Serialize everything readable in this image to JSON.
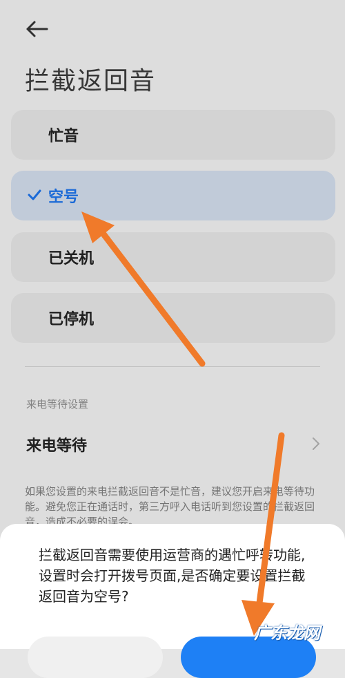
{
  "header": {
    "title": "拦截返回音",
    "back_icon": "arrow-left-icon"
  },
  "options": [
    {
      "label": "忙音",
      "selected": false
    },
    {
      "label": "空号",
      "selected": true
    },
    {
      "label": "已关机",
      "selected": false
    },
    {
      "label": "已停机",
      "selected": false
    }
  ],
  "call_waiting": {
    "section_label": "来电等待设置",
    "row_label": "来电等待",
    "description": "如果您设置的来电拦截返回音不是忙音，建议您开启来电等待功能。避免您正在通话时，第三方呼入电话听到您设置的拦截返回音，造成不必要的误会。"
  },
  "dialog": {
    "message": "拦截返回音需要使用运营商的遇忙呼转功能,设置时会打开拨号页面,是否确定要设置拦截返回音为空号?"
  },
  "watermark": "广东龙网",
  "colors": {
    "accent": "#1e80f5",
    "selected_bg": "#c9d4e2",
    "annotation_arrow": "#f07a2a"
  }
}
